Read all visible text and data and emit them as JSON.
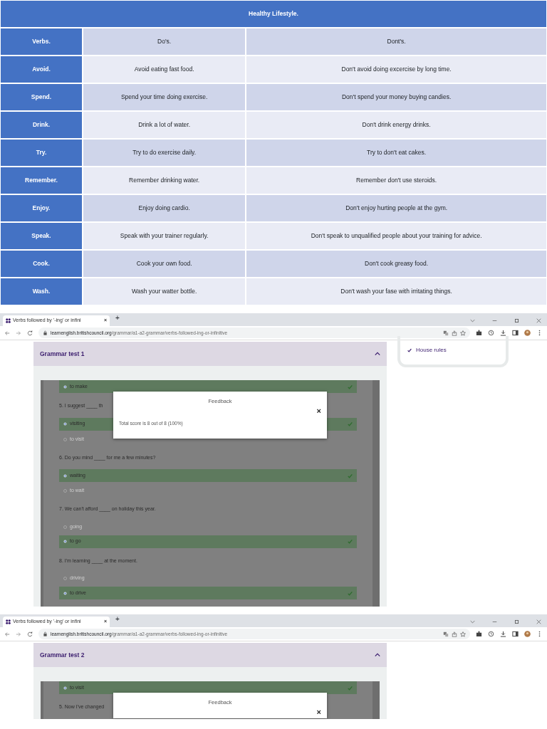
{
  "table": {
    "title": "Healthy Lifestyle.",
    "columns": [
      "Verbs.",
      "Do's.",
      "Dont's."
    ],
    "rows": [
      {
        "verb": "Avoid.",
        "do": "Avoid eating fast food.",
        "dont": "Don't avoid doing excercise by long time."
      },
      {
        "verb": "Spend.",
        "do": "Spend your time doing exercise.",
        "dont": "Don't spend your money buying candies."
      },
      {
        "verb": "Drink.",
        "do": "Drink a lot of water.",
        "dont": "Don't drink energy drinks."
      },
      {
        "verb": "Try.",
        "do": "Try to do exercise daily.",
        "dont": "Try to don't eat cakes."
      },
      {
        "verb": "Remember.",
        "do": "Remember drinking water.",
        "dont": "Remember don't use steroids."
      },
      {
        "verb": "Enjoy.",
        "do": "Enjoy doing cardio.",
        "dont": "Don't enjoy hurting people at the gym."
      },
      {
        "verb": "Speak.",
        "do": "Speak with your trainer regularly.",
        "dont": "Don't speak to unqualified people about your training for advice."
      },
      {
        "verb": "Cook.",
        "do": "Cook your own food.",
        "dont": "Don't cook greasy food."
      },
      {
        "verb": "Wash.",
        "do": "Wash your watter bottle.",
        "dont": "Don't wash your fase with irritating things."
      }
    ]
  },
  "screenshots": [
    {
      "tab_title": "Verbs followed by '-ing' or infini",
      "tab_close": "×",
      "new_tab": "+",
      "url_host": "learnenglish.britishcouncil.org",
      "url_path": "/grammar/a1-a2-grammar/verbs-followed-ing-or-infinitive",
      "section_title": "Grammar test 1",
      "expanded": true,
      "sidebar_item": "House rules",
      "items": [
        {
          "kind": "option",
          "text": "to make",
          "selected": true
        },
        {
          "kind": "question",
          "text": "5. I suggest ____ th"
        },
        {
          "kind": "option",
          "text": "visiting",
          "selected": true
        },
        {
          "kind": "option",
          "text": "to visit",
          "selected": false
        },
        {
          "kind": "question",
          "text": "6. Do you mind ____ for me a few minutes?"
        },
        {
          "kind": "option",
          "text": "waiting",
          "selected": true
        },
        {
          "kind": "option",
          "text": "to wait",
          "selected": false
        },
        {
          "kind": "question",
          "text": "7. We can't afford ____ on holiday this year."
        },
        {
          "kind": "option",
          "text": "going",
          "selected": false
        },
        {
          "kind": "option",
          "text": "to go",
          "selected": true
        },
        {
          "kind": "question",
          "text": "8. I'm learning ____ at the moment."
        },
        {
          "kind": "option",
          "text": "driving",
          "selected": false
        },
        {
          "kind": "option",
          "text": "to drive",
          "selected": true
        }
      ],
      "feedback": {
        "title": "Feedback",
        "close": "×",
        "message": "Total score is 8 out of 8 (100%)"
      }
    },
    {
      "tab_title": "Verbs followed by '-ing' or infini",
      "tab_close": "×",
      "new_tab": "+",
      "url_host": "learnenglish.britishcouncil.org",
      "url_path": "/grammar/a1-a2-grammar/verbs-followed-ing-or-infinitive",
      "section_title": "Grammar test 2",
      "expanded": true,
      "items": [
        {
          "kind": "option",
          "text": "to visit",
          "selected": true
        },
        {
          "kind": "question",
          "text": "5. Now I've changed"
        }
      ],
      "feedback": {
        "title": "Feedback",
        "close": "×"
      }
    }
  ]
}
